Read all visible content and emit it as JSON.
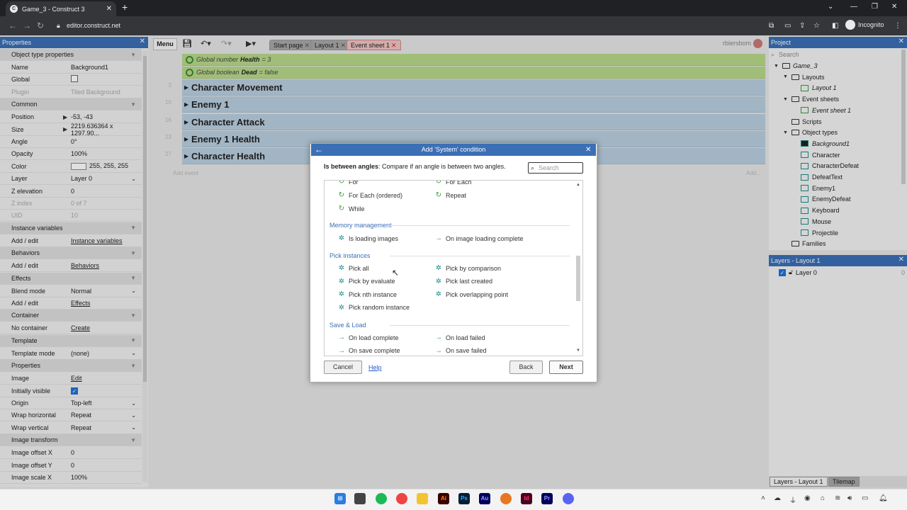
{
  "browser": {
    "tab_title": "Game_3 - Construct 3",
    "url": "editor.construct.net",
    "profile": "Incognito"
  },
  "toolbar": {
    "menu": "Menu",
    "tabs": [
      "Start page",
      "Layout 1",
      "Event sheet 1"
    ],
    "user": "rbiersbom"
  },
  "properties": {
    "title": "Properties",
    "rows": [
      {
        "k": "Object type properties",
        "v": "",
        "type": "section"
      },
      {
        "k": "Name",
        "v": "Background1"
      },
      {
        "k": "Global",
        "v": "",
        "type": "check",
        "checked": false
      },
      {
        "k": "Plugin",
        "v": "Tiled Background",
        "dim": true
      },
      {
        "k": "Common",
        "v": "",
        "type": "section"
      },
      {
        "k": "Position",
        "v": "-53, -43",
        "expand": true
      },
      {
        "k": "Size",
        "v": "2219.636364 x 1297.90...",
        "expand": true
      },
      {
        "k": "Angle",
        "v": "0°"
      },
      {
        "k": "Opacity",
        "v": "100%"
      },
      {
        "k": "Color",
        "v": "255, 255, 255",
        "type": "color"
      },
      {
        "k": "Layer",
        "v": "Layer 0",
        "type": "select"
      },
      {
        "k": "Z elevation",
        "v": "0"
      },
      {
        "k": "Z index",
        "v": "0 of 7",
        "dim": true
      },
      {
        "k": "UID",
        "v": "10",
        "dim": true
      },
      {
        "k": "Instance variables",
        "v": "",
        "type": "section"
      },
      {
        "k": "Add / edit",
        "v": "Instance variables",
        "type": "link"
      },
      {
        "k": "Behaviors",
        "v": "",
        "type": "section"
      },
      {
        "k": "Add / edit",
        "v": "Behaviors",
        "type": "link"
      },
      {
        "k": "Effects",
        "v": "",
        "type": "section"
      },
      {
        "k": "Blend mode",
        "v": "Normal",
        "type": "select"
      },
      {
        "k": "Add / edit",
        "v": "Effects",
        "type": "link"
      },
      {
        "k": "Container",
        "v": "",
        "type": "section"
      },
      {
        "k": "No container",
        "v": "Create",
        "type": "link"
      },
      {
        "k": "Template",
        "v": "",
        "type": "section"
      },
      {
        "k": "Template mode",
        "v": "(none)",
        "type": "select"
      },
      {
        "k": "Properties",
        "v": "",
        "type": "section"
      },
      {
        "k": "Image",
        "v": "Edit",
        "type": "link"
      },
      {
        "k": "Initially visible",
        "v": "",
        "type": "check",
        "checked": true
      },
      {
        "k": "Origin",
        "v": "Top-left",
        "type": "select"
      },
      {
        "k": "Wrap horizontal",
        "v": "Repeat",
        "type": "select"
      },
      {
        "k": "Wrap vertical",
        "v": "Repeat",
        "type": "select"
      },
      {
        "k": "Image transform",
        "v": "",
        "type": "section"
      },
      {
        "k": "Image offset X",
        "v": "0"
      },
      {
        "k": "Image offset Y",
        "v": "0"
      },
      {
        "k": "Image scale X",
        "v": "100%"
      }
    ]
  },
  "sheet": {
    "globals": [
      {
        "pre": "Global number",
        "name": "Health",
        "post": "= 3"
      },
      {
        "pre": "Global boolean",
        "name": "Dead",
        "post": "= false"
      }
    ],
    "groups": [
      {
        "num": "3",
        "title": "Character Movement"
      },
      {
        "num": "10",
        "title": "Enemy 1"
      },
      {
        "num": "16",
        "title": "Character Attack"
      },
      {
        "num": "23",
        "title": "Enemy 1 Health"
      },
      {
        "num": "27",
        "title": "Character Health"
      }
    ],
    "add_event": "Add event",
    "add_action": "Add..."
  },
  "project": {
    "title": "Project",
    "search": "Search",
    "tree": [
      {
        "label": "Game_3",
        "kind": "folder",
        "italic": true,
        "tw": "▼"
      },
      {
        "label": "Layouts",
        "kind": "folder",
        "tw": "▼"
      },
      {
        "label": "Layout 1",
        "kind": "layout",
        "italic": true
      },
      {
        "label": "Event sheets",
        "kind": "folder",
        "tw": "▼"
      },
      {
        "label": "Event sheet 1",
        "kind": "sheet",
        "italic": true
      },
      {
        "label": "Scripts",
        "kind": "folder"
      },
      {
        "label": "Object types",
        "kind": "folder",
        "tw": "▼"
      },
      {
        "label": "Background1",
        "kind": "obj",
        "italic": true
      },
      {
        "label": "Character",
        "kind": "obj"
      },
      {
        "label": "CharacterDefeat",
        "kind": "obj"
      },
      {
        "label": "DefeatText",
        "kind": "obj"
      },
      {
        "label": "Enemy1",
        "kind": "obj"
      },
      {
        "label": "EnemyDefeat",
        "kind": "obj"
      },
      {
        "label": "Keyboard",
        "kind": "obj"
      },
      {
        "label": "Mouse",
        "kind": "obj"
      },
      {
        "label": "Projectile",
        "kind": "obj"
      },
      {
        "label": "Families",
        "kind": "folder"
      }
    ]
  },
  "layers": {
    "title": "Layers - Layout 1",
    "items": [
      {
        "label": "Layer 0",
        "count": "0"
      }
    ],
    "bottom_tabs": [
      "Layers - Layout 1",
      "Tilemap"
    ]
  },
  "dialog": {
    "title": "Add 'System' condition",
    "desc_bold": "Is between angles",
    "desc": ": Compare if an angle is between two angles.",
    "search_placeholder": "Search",
    "partial_top": [
      "For",
      "For Each"
    ],
    "loop_items": [
      {
        "left": "For Each (ordered)",
        "right": "Repeat"
      },
      {
        "left": "While",
        "right": ""
      }
    ],
    "categories": [
      {
        "name": "Memory management",
        "items": [
          [
            "Is loading images",
            "gear"
          ],
          [
            "On image loading complete",
            "trig"
          ]
        ]
      },
      {
        "name": "Pick instances",
        "items": [
          [
            "Pick all",
            "gear"
          ],
          [
            "Pick by comparison",
            "gear"
          ],
          [
            "Pick by evaluate",
            "gear"
          ],
          [
            "Pick last created",
            "gear"
          ],
          [
            "Pick nth instance",
            "gear"
          ],
          [
            "Pick overlapping point",
            "gear"
          ],
          [
            "Pick random instance",
            "gear"
          ]
        ]
      },
      {
        "name": "Save & Load",
        "items": [
          [
            "On load complete",
            "trig"
          ],
          [
            "On load failed",
            "trig"
          ],
          [
            "On save complete",
            "trig"
          ],
          [
            "On save failed",
            "trig"
          ]
        ]
      }
    ],
    "cancel": "Cancel",
    "help": "Help",
    "back": "Back",
    "next": "Next"
  }
}
